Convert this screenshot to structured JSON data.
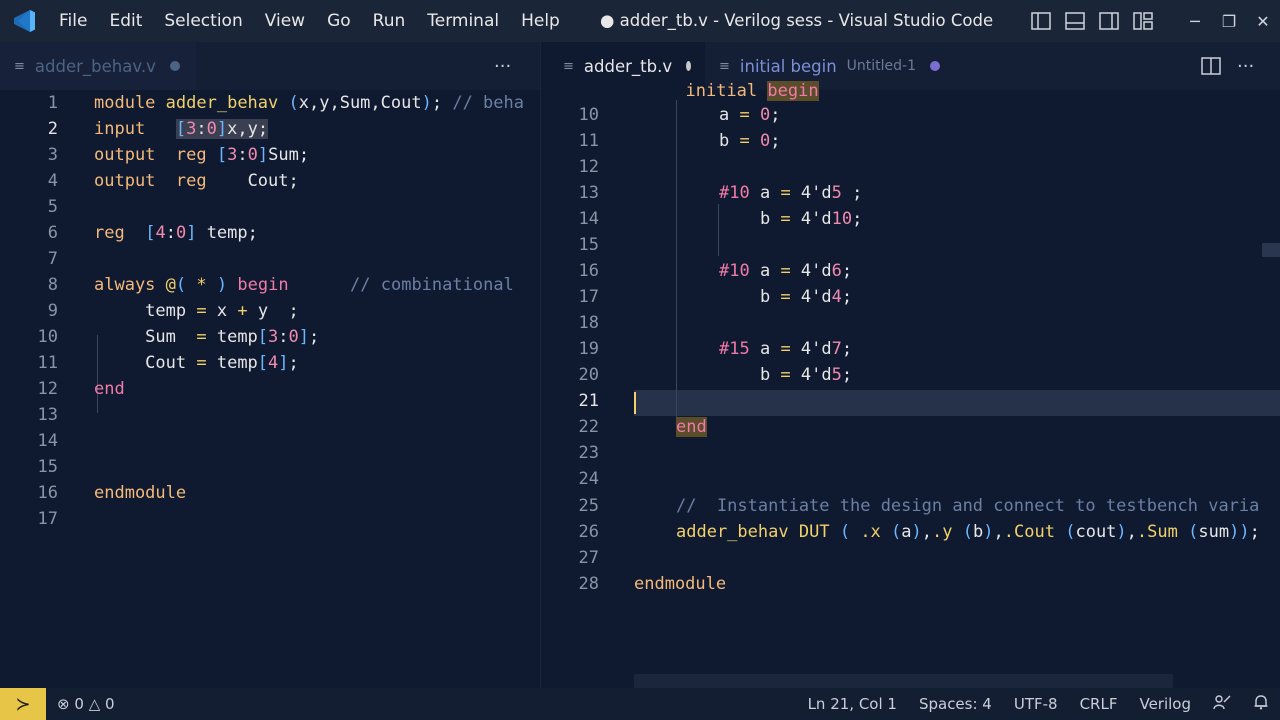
{
  "window": {
    "title": "● adder_tb.v - Verilog sess - Visual Studio Code",
    "menu": [
      "File",
      "Edit",
      "Selection",
      "View",
      "Go",
      "Run",
      "Terminal",
      "Help"
    ],
    "controls": [
      "layout-sidebar-icon",
      "layout-panel-icon",
      "layout-secondary-icon",
      "customize-layout-icon",
      "minimize-icon",
      "restore-icon",
      "close-icon"
    ]
  },
  "left_editor": {
    "tab": {
      "label": "adder_behav.v"
    },
    "more_actions": "···"
  },
  "right_editor": {
    "tabs": [
      {
        "label": "adder_tb.v"
      },
      {
        "label": "initial begin",
        "detail": "Untitled-1"
      }
    ],
    "more_actions": "···"
  },
  "statusbar": {
    "errors": "0",
    "warnings": "0",
    "position": "Ln 21, Col 1",
    "spaces": "Spaces: 4",
    "encoding": "UTF-8",
    "eol": "CRLF",
    "language": "Verilog"
  },
  "colors": {
    "accent": "#e7c547",
    "background": "#0f1a30",
    "keyword": "#f4b97a",
    "number": "#f08ab0"
  }
}
